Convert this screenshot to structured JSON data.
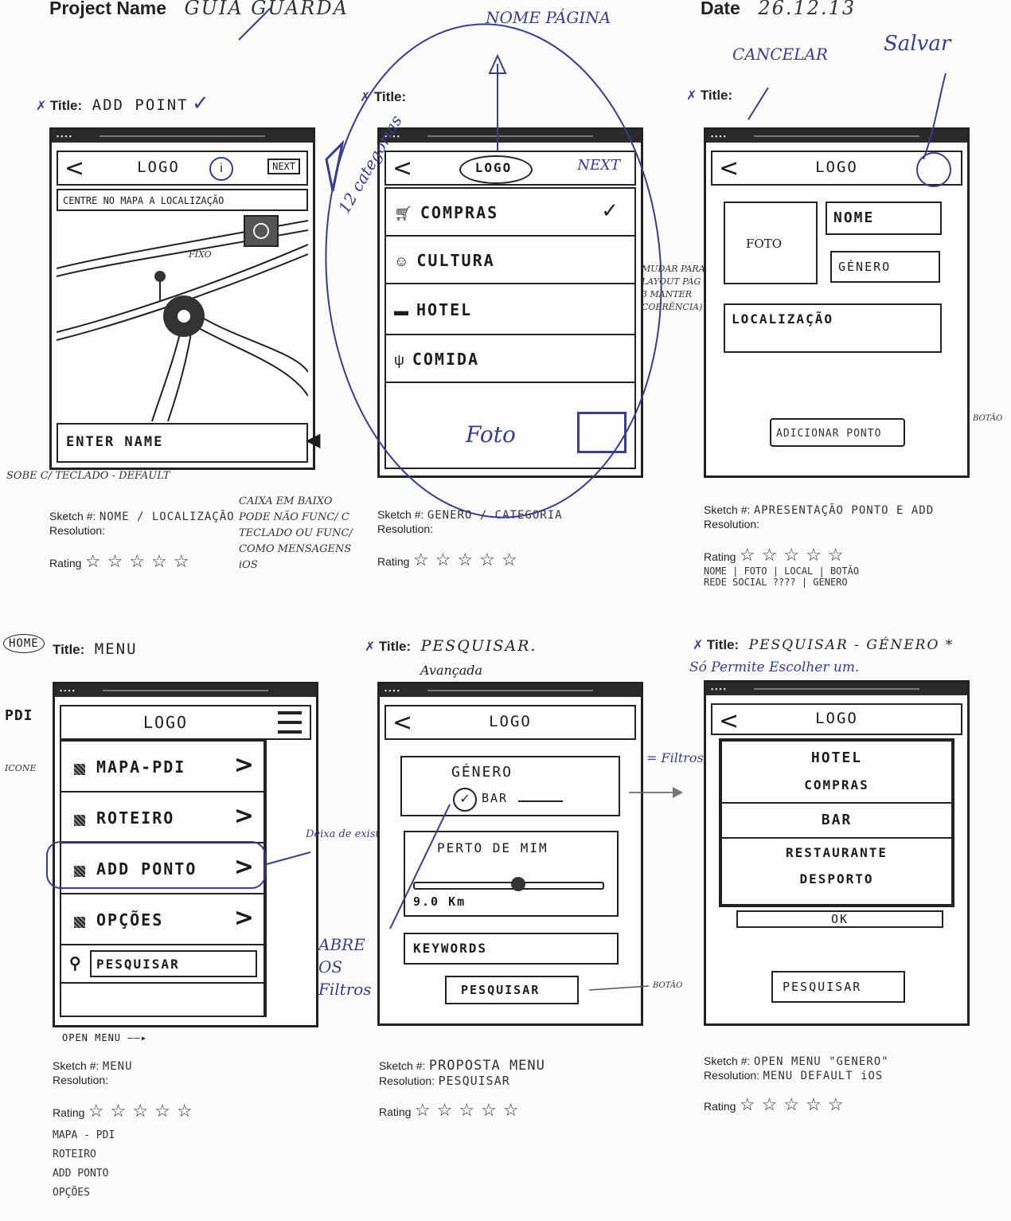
{
  "header": {
    "project_label": "Project Name",
    "project_value": "GUIA GUARDA",
    "date_label": "Date",
    "date_value": "26.12.13"
  },
  "top_annotations": {
    "nome_pagina": "NOME PÁGINA",
    "cancelar": "CANCELAR",
    "salvar": "Salvar"
  },
  "sketch1": {
    "title_label": "Title:",
    "title_value": "ADD POINT",
    "logo": "LOGO",
    "next": "NEXT",
    "hint": "CENTRE NO MAPA A LOCALIZAÇÃO",
    "map_note": "FIXO",
    "input": "ENTER NAME",
    "sketch_label": "Sketch #:",
    "sketch_value": "NOME / LOCALIZAÇÃO",
    "resolution_label": "Resolution:",
    "rating_label": "Rating",
    "note_left": "SOBE C/ TECLADO - DEFAULT",
    "note_right": "CAIXA EM BAIXO PODE NÃO FUNC/ C TECLADO OU FUNC/ COMO MENSAGENS iOS"
  },
  "sketch2": {
    "title_label": "Title:",
    "title_value": "",
    "logo": "LOGO",
    "next": "NEXT",
    "categories": [
      "COMPRAS",
      "CULTURA",
      "HOTEL",
      "COMIDA"
    ],
    "side_note": "12 categorias",
    "foto": "Foto",
    "sketch_label": "Sketch #:",
    "sketch_value": "GENERO / CATEGORIA",
    "resolution_label": "Resolution:",
    "rating_label": "Rating"
  },
  "sketch3": {
    "title_label": "Title:",
    "title_value": "",
    "logo": "LOGO",
    "foto": "FOTO",
    "nome": "NOME",
    "genero": "GÉNERO",
    "localizacao": "LOCALIZAÇÃO",
    "button": "ADICIONAR PONTO",
    "side_note": "MUDAR PARA LAYOUT PÁG 3 MANTER COERÊNCIA)",
    "botao": "BOTÃO",
    "sketch_label": "Sketch #:",
    "sketch_value": "APRESENTAÇÃO PONTO E ADD",
    "resolution_label": "Resolution:",
    "rating_label": "Rating",
    "note_line1": "NOME | FOTO | LOCAL | BOTÃO",
    "note_line2": "REDE SOCIAL ???? | GÉNERO"
  },
  "sketch4": {
    "side_label_home": "HOME",
    "title_label": "Title:",
    "title_value": "MENU",
    "pdi": "PDI",
    "icone": "ICONE",
    "logo": "LOGO",
    "items": [
      "MAPA-PDI",
      "ROTEIRO",
      "ADD PONTO",
      "OPÇÕES"
    ],
    "search": "PESQUISAR",
    "deixa_note": "Deixa de existir",
    "open_menu": "OPEN MENU",
    "sketch_label": "Sketch #:",
    "sketch_value": "MENU",
    "resolution_label": "Resolution:",
    "rating_label": "Rating",
    "list_notes": [
      "MAPA - PDI",
      "ROTEIRO",
      "ADD PONTO",
      "OPÇÕES"
    ]
  },
  "sketch5": {
    "title_label": "Title:",
    "title_value": "PESQUISAR.",
    "title_sub": "Avançada",
    "logo": "LOGO",
    "genero": "GÉNERO",
    "bar": "BAR",
    "perto": "PERTO DE MIM",
    "slider_value": 0.55,
    "distance": "9.0 Km",
    "keywords": "KEYWORDS",
    "button": "PESQUISAR",
    "filtros_note": "= Filtros",
    "abre_note": "ABRE OS Filtros",
    "botao": "BOTÃO",
    "sketch_label": "Sketch #:",
    "sketch_value": "PROPOSTA MENU",
    "resolution_label": "Resolution:",
    "resolution_value": "PESQUISAR",
    "rating_label": "Rating"
  },
  "sketch6": {
    "title_label": "Title:",
    "title_value": "PESQUISAR - GÉNERO *",
    "title_sub": "Só Permite Escolher um.",
    "logo": "LOGO",
    "options": [
      "HOTEL",
      "COMPRAS",
      "BAR",
      "RESTAURANTE",
      "DESPORTO"
    ],
    "ok": "OK",
    "button": "PESQUISAR",
    "sketch_label": "Sketch #:",
    "sketch_value": "OPEN MENU \"GENERO\"",
    "resolution_label": "Resolution:",
    "resolution_value": "MENU DEFAULT iOS",
    "rating_label": "Rating"
  },
  "rating_stars": "☆☆☆☆☆",
  "icons": {
    "back": "chevron-left-icon",
    "chevron": "chevron-right-icon",
    "hamburger": "hamburger-icon",
    "search": "search-icon",
    "check": "checkmark-icon",
    "pin": "map-pin-icon",
    "location": "location-target-icon",
    "send": "send-icon",
    "cart": "cart-icon",
    "theater": "theater-mask-icon",
    "bed": "bed-icon",
    "fork": "fork-knife-icon",
    "photo": "photo-icon",
    "star": "star-icon"
  }
}
